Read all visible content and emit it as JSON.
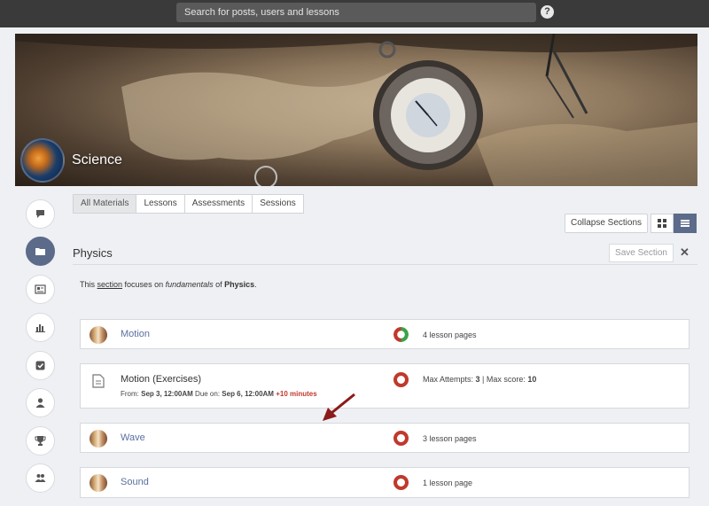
{
  "search": {
    "placeholder": "Search for posts, users and lessons",
    "help_glyph": "?"
  },
  "course": {
    "title": "Science"
  },
  "rail": [
    {
      "name": "chat-icon"
    },
    {
      "name": "folder-icon",
      "active": true
    },
    {
      "name": "newspaper-icon"
    },
    {
      "name": "bar-chart-icon"
    },
    {
      "name": "checkbox-icon"
    },
    {
      "name": "user-icon"
    },
    {
      "name": "trophy-icon"
    },
    {
      "name": "users-icon"
    }
  ],
  "tabs": [
    "All Materials",
    "Lessons",
    "Assessments",
    "Sessions"
  ],
  "toolbar": {
    "collapse_label": "Collapse Sections"
  },
  "section": {
    "title": "Physics",
    "save_label": "Save Section",
    "close_glyph": "✕",
    "desc": {
      "t1": "This ",
      "t2": "section",
      "t3": " focuses on ",
      "t4": "fundamentals",
      "t5": " of ",
      "t6": "Physics",
      "t7": "."
    }
  },
  "items": [
    {
      "title": "Motion",
      "meta": "4 lesson pages",
      "ring_color": "#c0392b",
      "ring_accent": "#3aa24a"
    },
    {
      "title": "Motion (Exercises)",
      "meta_attempts_label": "Max Attempts: ",
      "meta_attempts": "3",
      "meta_sep": " | ",
      "meta_score_label": "Max score: ",
      "meta_score": "10",
      "from_label": "From: ",
      "from": "Sep 3, 12:00AM",
      "due_label": "  Due on: ",
      "due": "Sep 6, 12:00AM",
      "extra": "  +10 minutes",
      "ring_color": "#c0392b"
    },
    {
      "title": "Wave",
      "meta": "3 lesson pages",
      "ring_color": "#c0392b"
    },
    {
      "title": "Sound",
      "meta": "1 lesson page",
      "ring_color": "#c0392b"
    }
  ],
  "colors": {
    "accent": "#5c6b8a",
    "link": "#5a6fa0",
    "danger": "#c0392b",
    "arrow": "#8b1a1a"
  }
}
